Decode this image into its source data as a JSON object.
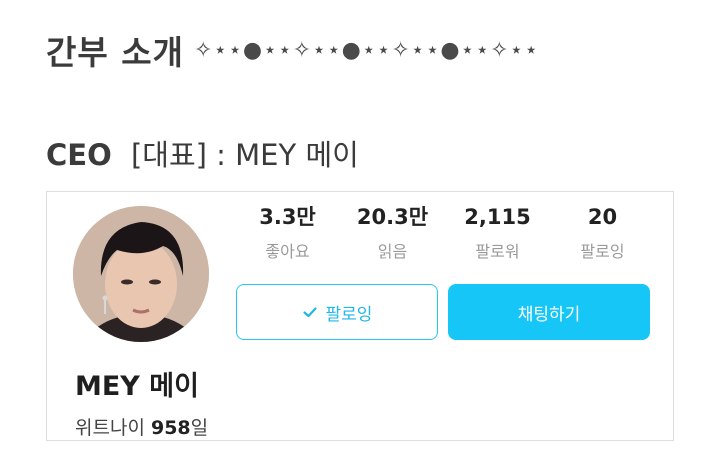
{
  "section": {
    "title": "간부 소개",
    "decoration": "✧⋆⋆●⋆⋆✧⋆⋆●⋆⋆✧⋆⋆●⋆⋆✧⋆⋆"
  },
  "role_line": {
    "role": "CEO",
    "detail": "[대표] : MEY 메이"
  },
  "profile": {
    "display_name": "MEY 메이",
    "days_prefix": "위트나이",
    "days_count": "958",
    "days_suffix": "일",
    "stats": [
      {
        "value": "3.3만",
        "label": "좋아요"
      },
      {
        "value": "20.3만",
        "label": "읽음"
      },
      {
        "value": "2,115",
        "label": "팔로워"
      },
      {
        "value": "20",
        "label": "팔로잉"
      }
    ],
    "follow_button": "팔로잉",
    "chat_button": "채팅하기"
  },
  "colors": {
    "accent": "#16c6f6",
    "follow_border": "#27c8f5"
  }
}
